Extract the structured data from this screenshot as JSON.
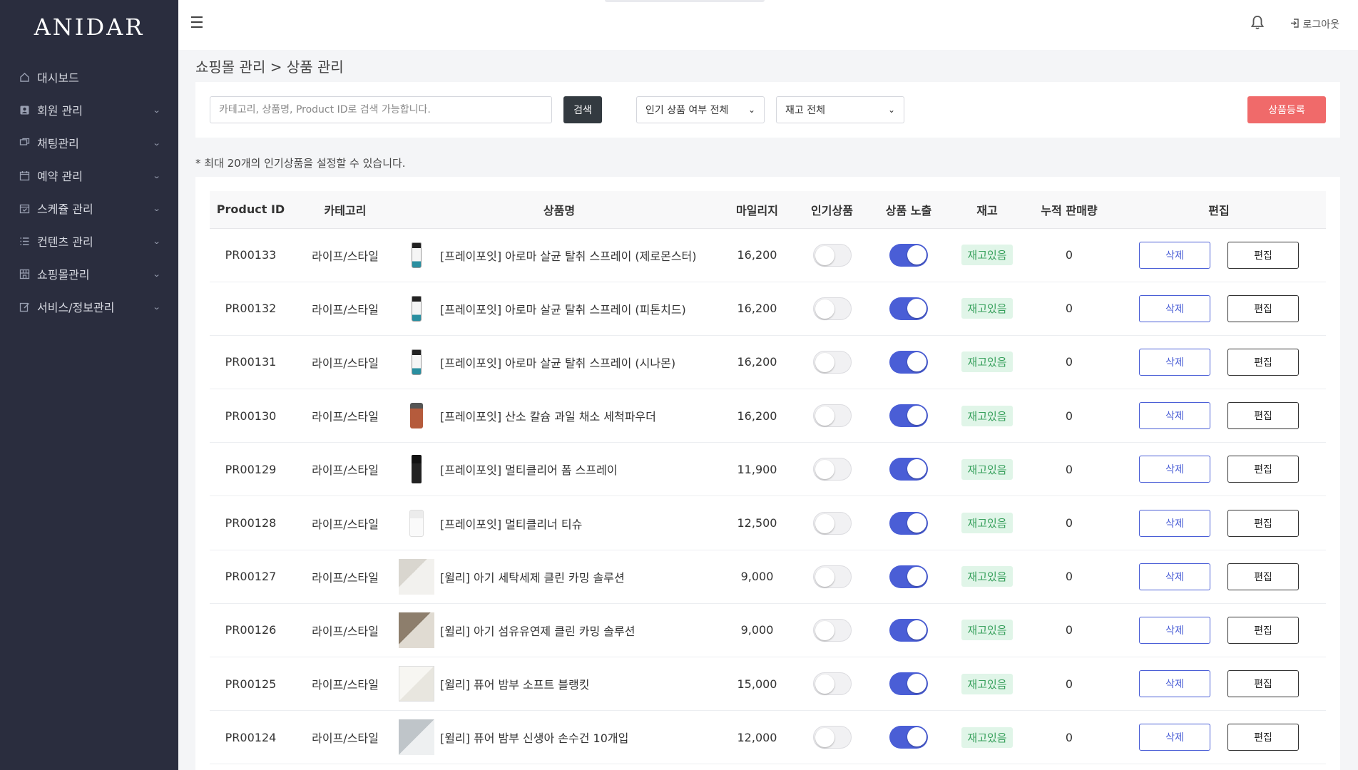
{
  "app": {
    "logo": "ANIDAR"
  },
  "sidebar": {
    "items": [
      {
        "label": "대시보드",
        "icon": "home-icon",
        "has_chevron": false
      },
      {
        "label": "회원 관리",
        "icon": "member-icon",
        "has_chevron": true
      },
      {
        "label": "채팅관리",
        "icon": "chat-icon",
        "has_chevron": true
      },
      {
        "label": "예약 관리",
        "icon": "calendar-icon",
        "has_chevron": true
      },
      {
        "label": "스케쥴 관리",
        "icon": "schedule-icon",
        "has_chevron": true
      },
      {
        "label": "컨텐츠 관리",
        "icon": "list-icon",
        "has_chevron": true
      },
      {
        "label": "쇼핑몰관리",
        "icon": "store-icon",
        "has_chevron": true
      },
      {
        "label": "서비스/정보관리",
        "icon": "edit-icon",
        "has_chevron": true
      }
    ]
  },
  "topbar": {
    "logout_label": "로그아웃"
  },
  "breadcrumb": "쇼핑몰 관리 > 상품 관리",
  "filters": {
    "search_placeholder": "카테고리, 상품명, Product ID로 검색 가능합니다.",
    "search_value": "",
    "search_button": "검색",
    "popular_select": "인기 상품 여부 전체",
    "stock_select": "재고 전체",
    "register_button": "상품등록"
  },
  "note": "* 최대 20개의 인기상품을 설정할 수 있습니다.",
  "table": {
    "headers": [
      "Product ID",
      "카테고리",
      "상품명",
      "마일리지",
      "인기상품",
      "상품 노출",
      "재고",
      "누적 판매량",
      "편집"
    ],
    "delete_label": "삭제",
    "edit_label": "편집",
    "rows": [
      {
        "id": "PR00133",
        "category": "라이프/스타일",
        "name": "[프레이포잇] 아로마 살균 탈취 스프레이 (제로몬스터)",
        "thumb": "bottle",
        "mileage": "16,200",
        "popular": false,
        "exposed": true,
        "stock": "재고있음",
        "sales": "0"
      },
      {
        "id": "PR00132",
        "category": "라이프/스타일",
        "name": "[프레이포잇] 아로마 살균 탈취 스프레이 (피톤치드)",
        "thumb": "bottle",
        "mileage": "16,200",
        "popular": false,
        "exposed": true,
        "stock": "재고있음",
        "sales": "0"
      },
      {
        "id": "PR00131",
        "category": "라이프/스타일",
        "name": "[프레이포잇] 아로마 살균 탈취 스프레이 (시나몬)",
        "thumb": "bottle",
        "mileage": "16,200",
        "popular": false,
        "exposed": true,
        "stock": "재고있음",
        "sales": "0"
      },
      {
        "id": "PR00130",
        "category": "라이프/스타일",
        "name": "[프레이포잇] 산소 칼슘 과일 채소 세척파우더",
        "thumb": "jar",
        "mileage": "16,200",
        "popular": false,
        "exposed": true,
        "stock": "재고있음",
        "sales": "0"
      },
      {
        "id": "PR00129",
        "category": "라이프/스타일",
        "name": "[프레이포잇] 멀티클리어 폼 스프레이",
        "thumb": "spray",
        "mileage": "11,900",
        "popular": false,
        "exposed": true,
        "stock": "재고있음",
        "sales": "0"
      },
      {
        "id": "PR00128",
        "category": "라이프/스타일",
        "name": "[프레이포잇] 멀티클리너 티슈",
        "thumb": "tissue",
        "mileage": "12,500",
        "popular": false,
        "exposed": true,
        "stock": "재고있음",
        "sales": "0"
      },
      {
        "id": "PR00127",
        "category": "라이프/스타일",
        "name": "[윌리] 아기 세탁세제 클린 카밍 솔루션",
        "thumb": "photo1",
        "mileage": "9,000",
        "popular": false,
        "exposed": true,
        "stock": "재고있음",
        "sales": "0"
      },
      {
        "id": "PR00126",
        "category": "라이프/스타일",
        "name": "[윌리] 아기 섬유유연제 클린 카밍 솔루션",
        "thumb": "photo2",
        "mileage": "9,000",
        "popular": false,
        "exposed": true,
        "stock": "재고있음",
        "sales": "0"
      },
      {
        "id": "PR00125",
        "category": "라이프/스타일",
        "name": "[윌리] 퓨어 밤부 소프트 블랭킷",
        "thumb": "photo3",
        "mileage": "15,000",
        "popular": false,
        "exposed": true,
        "stock": "재고있음",
        "sales": "0"
      },
      {
        "id": "PR00124",
        "category": "라이프/스타일",
        "name": "[윌리] 퓨어 밤부 신생아 손수건 10개입",
        "thumb": "photo4",
        "mileage": "12,000",
        "popular": false,
        "exposed": true,
        "stock": "재고있음",
        "sales": "0"
      }
    ]
  },
  "colors": {
    "sidebar_bg": "#2a2d3e",
    "accent": "#4a5ed6",
    "register": "#f06a6a",
    "stock_green": "#37a05c"
  }
}
